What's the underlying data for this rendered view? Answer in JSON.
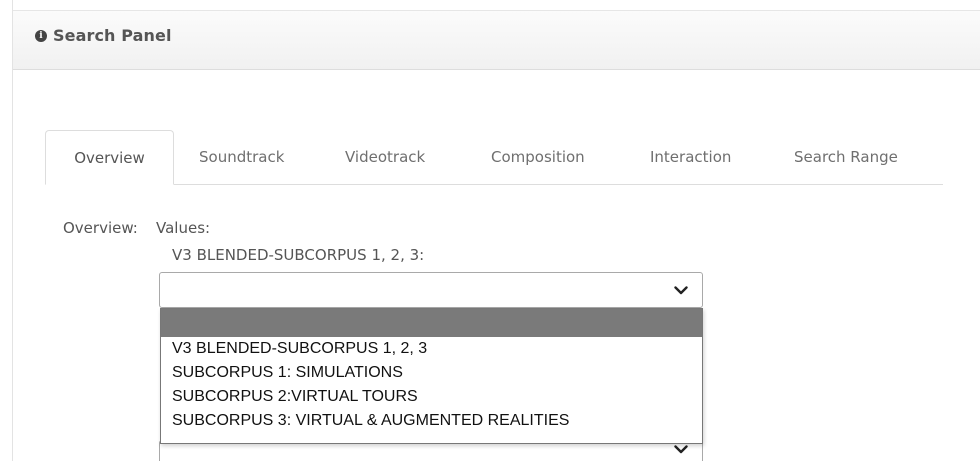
{
  "panel": {
    "title": "Search Panel",
    "icon": "info-icon"
  },
  "tabs": [
    {
      "label": "Overview",
      "active": true
    },
    {
      "label": "Soundtrack",
      "active": false
    },
    {
      "label": "Videotrack",
      "active": false
    },
    {
      "label": "Composition",
      "active": false
    },
    {
      "label": "Interaction",
      "active": false
    },
    {
      "label": "Search Range",
      "active": false
    }
  ],
  "overview": {
    "label": "Overview:",
    "values_label": "Values:",
    "corpus_label": "V3 BLENDED-SUBCORPUS 1, 2, 3:",
    "select_value": "",
    "dropdown_options": [
      "",
      "V3 BLENDED-SUBCORPUS 1, 2, 3",
      "SUBCORPUS 1: SIMULATIONS",
      "SUBCORPUS 2:VIRTUAL TOURS",
      "SUBCORPUS 3: VIRTUAL & AUGMENTED REALITIES"
    ],
    "highlighted_option_index": 0
  },
  "colors": {
    "header_bg": "#f4f4f4",
    "highlight": "#7a7a7a",
    "border": "#dddddd",
    "text": "#555555"
  }
}
